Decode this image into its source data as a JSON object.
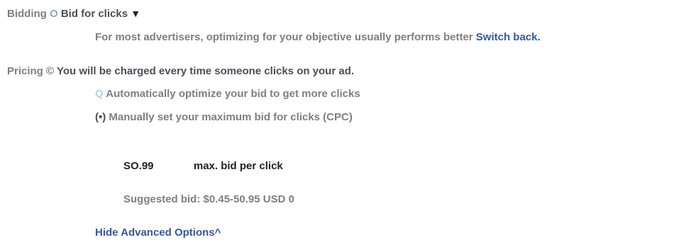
{
  "bidding": {
    "label": "Bidding",
    "radio_glyph": "O",
    "option_label": "Bid for clicks",
    "dropdown_glyph": "▼",
    "note": "For most advertisers, optimizing for your objective usually performs better",
    "switch_back": "Switch back."
  },
  "pricing": {
    "label": "Pricing",
    "info_glyph": "©",
    "description": "You will be charged every time someone clicks on your ad.",
    "options": [
      {
        "glyph": "Q",
        "label": "Automatically optimize your bid to get more clicks"
      },
      {
        "glyph": "(•)",
        "label": "Manually set your maximum bid for clicks (CPC)"
      }
    ]
  },
  "bid": {
    "value": "SO.99",
    "unit_label": "max. bid per click",
    "suggested": "Suggested bid: $0.45-50.95 USD 0"
  },
  "advanced_options_link": "Hide Advanced Options^",
  "colors": {
    "link": "#365899",
    "muted_text": "#7f7f7f",
    "primary_text": "#4b4f56"
  }
}
